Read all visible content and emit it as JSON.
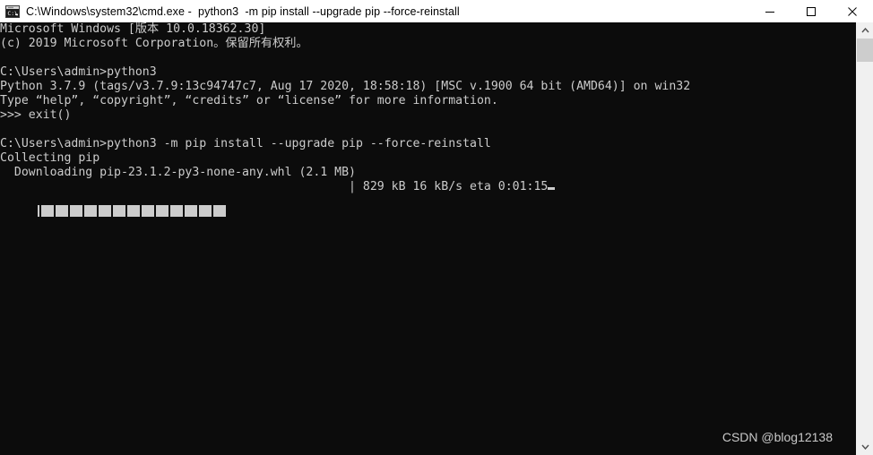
{
  "window": {
    "title": "C:\\Windows\\system32\\cmd.exe -  python3  -m pip install --upgrade pip --force-reinstall",
    "icon": "cmd-console-icon",
    "bg_color": "#0c0c0c",
    "text_color": "#cccccc",
    "titlebar_bg": "#ffffff"
  },
  "controls": {
    "minimize_label": "—",
    "maximize_label": "☐",
    "close_label": "✕"
  },
  "console": {
    "lines": [
      "Microsoft Windows [版本 10.0.18362.30]",
      "(c) 2019 Microsoft Corporation。保留所有权利。",
      "",
      "C:\\Users\\admin>python3",
      "Python 3.7.9 (tags/v3.7.9:13c94747c7, Aug 17 2020, 18:58:18) [MSC v.1900 64 bit (AMD64)] on win32",
      "Type “help”, “copyright”, “credits” or “license” for more information.",
      ">>> exit()",
      "",
      "C:\\Users\\admin>python3 -m pip install --upgrade pip --force-reinstall",
      "Collecting pip",
      "  Downloading pip-23.1.2-py3-none-any.whl (2.1 MB)"
    ],
    "progress": {
      "left_pipe": "|",
      "filled_blocks": 13,
      "block_char": "█",
      "right_pipe": "|",
      "status": "829 kB 16 kB/s eta 0:01:15",
      "downloaded": "829 kB",
      "speed": "16 kB/s",
      "eta": "0:01:15",
      "cursor": "_"
    }
  },
  "watermark": {
    "text": "CSDN @blog12138"
  },
  "scrollbar": {
    "up_arrow": "⌃",
    "down_arrow": "⌄"
  }
}
